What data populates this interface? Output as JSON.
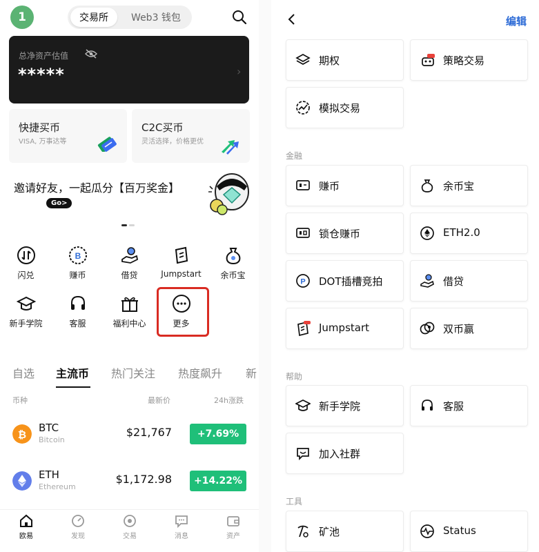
{
  "left": {
    "avatar_text": "1",
    "segment": {
      "active": "交易所",
      "inactive": "Web3 钱包"
    },
    "asset": {
      "label": "总净资产估值",
      "value": "*****"
    },
    "quick_cards": [
      {
        "title": "快捷买币",
        "sub": "VISA, 万事达等"
      },
      {
        "title": "C2C买币",
        "sub": "灵活选择，价格更优"
      }
    ],
    "invite": {
      "text": "邀请好友，一起瓜分【百万奖金】",
      "go": "Go>"
    },
    "grid": [
      {
        "label": "闪兑",
        "icon": "swap-icon"
      },
      {
        "label": "赚币",
        "icon": "earn-coin-icon"
      },
      {
        "label": "借贷",
        "icon": "loan-icon"
      },
      {
        "label": "Jumpstart",
        "icon": "jumpstart-icon"
      },
      {
        "label": "余币宝",
        "icon": "savings-bag-icon"
      },
      {
        "label": "新手学院",
        "icon": "academy-cap-icon"
      },
      {
        "label": "客服",
        "icon": "headset-icon"
      },
      {
        "label": "福利中心",
        "icon": "gift-icon"
      },
      {
        "label": "更多",
        "icon": "more-icon"
      }
    ],
    "tabs": [
      "自选",
      "主流币",
      "热门关注",
      "热度飙升",
      "新"
    ],
    "table_header": {
      "coin": "币种",
      "price": "最新价",
      "change": "24h涨跌"
    },
    "rows": [
      {
        "symbol": "BTC",
        "name": "Bitcoin",
        "price": "$21,767",
        "change": "+7.69%"
      },
      {
        "symbol": "ETH",
        "name": "Ethereum",
        "price": "$1,172.98",
        "change": "+14.22%"
      }
    ],
    "bottom_nav": [
      "欧易",
      "发现",
      "交易",
      "消息",
      "资产"
    ]
  },
  "right": {
    "edit": "编辑",
    "top_items": [
      "期权",
      "策略交易",
      "模拟交易"
    ],
    "sections": {
      "finance": "金融",
      "help": "帮助",
      "tools": "工具"
    },
    "finance_items": [
      "赚币",
      "余币宝",
      "锁仓赚币",
      "ETH2.0",
      "DOT插槽竞拍",
      "借贷",
      "Jumpstart",
      "双币赢"
    ],
    "help_items": [
      "新手学院",
      "客服",
      "加入社群"
    ],
    "tool_items": [
      "矿池",
      "Status"
    ]
  },
  "colors": {
    "green": "#1fbf79",
    "accent_blue": "#2d6bd6",
    "highlight_red": "#d92b22",
    "btc": "#f7931a",
    "eth": "#627eea"
  }
}
